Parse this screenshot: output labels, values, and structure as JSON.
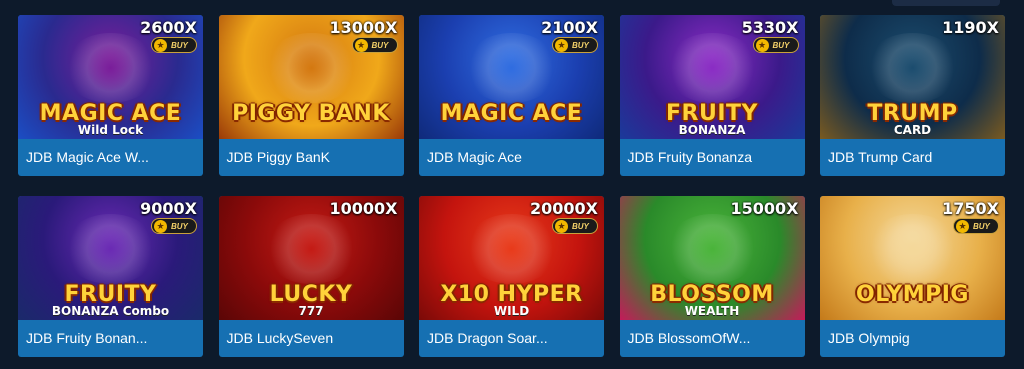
{
  "games": [
    {
      "name": "JDB Magic Ace W...",
      "multiplier": "2600X",
      "art_title": "MAGIC ACE",
      "art_sub": "Wild Lock",
      "buy": "BUY",
      "colors": [
        "#2a2a8f",
        "#7a1d9a",
        "#1b4ec4"
      ]
    },
    {
      "name": "JDB Piggy BanK",
      "multiplier": "13000X",
      "art_title": "PIGGY BANK",
      "art_sub": "",
      "buy": "BUY",
      "colors": [
        "#f0a81a",
        "#d47810",
        "#9a3a08"
      ]
    },
    {
      "name": "JDB Magic Ace",
      "multiplier": "2100X",
      "art_title": "MAGIC ACE",
      "art_sub": "",
      "buy": "BUY",
      "colors": [
        "#1b3fb0",
        "#2f6ce0",
        "#0f2a7a"
      ]
    },
    {
      "name": "JDB Fruity Bonanza",
      "multiplier": "5330X",
      "art_title": "FRUITY",
      "art_sub": "BONANZA",
      "buy": "BUY",
      "colors": [
        "#3b1a8a",
        "#8a2cc4",
        "#1a3a9a"
      ]
    },
    {
      "name": "JDB Trump Card",
      "multiplier": "1190X",
      "art_title": "TRUMP",
      "art_sub": "CARD",
      "buy": "",
      "colors": [
        "#0e2c4a",
        "#1b4c6e",
        "#7a5a20"
      ]
    },
    {
      "name": "JDB Fruity Bonan...",
      "multiplier": "9000X",
      "art_title": "FRUITY",
      "art_sub": "BONANZA Combo",
      "buy": "BUY",
      "colors": [
        "#2a1a7a",
        "#6a2ab4",
        "#1a2a6a"
      ]
    },
    {
      "name": "JDB LuckySeven",
      "multiplier": "10000X",
      "art_title": "LUCKY",
      "art_sub": "777",
      "buy": "",
      "colors": [
        "#8a0a0a",
        "#c41a14",
        "#5a0606"
      ]
    },
    {
      "name": "JDB Dragon Soar...",
      "multiplier": "20000X",
      "art_title": "X10 HYPER",
      "art_sub": "WILD",
      "buy": "BUY",
      "colors": [
        "#c4140e",
        "#e83a1a",
        "#7a0a08"
      ]
    },
    {
      "name": "JDB BlossomOfW...",
      "multiplier": "15000X",
      "art_title": "BLOSSOM",
      "art_sub": "WEALTH",
      "buy": "",
      "colors": [
        "#2a8a2a",
        "#4ab43a",
        "#c41a5a"
      ]
    },
    {
      "name": "JDB Olympig",
      "multiplier": "1750X",
      "art_title": "OLYMPIG",
      "art_sub": "",
      "buy": "BUY",
      "colors": [
        "#e8b04a",
        "#f4d89a",
        "#c47a1a"
      ]
    }
  ]
}
